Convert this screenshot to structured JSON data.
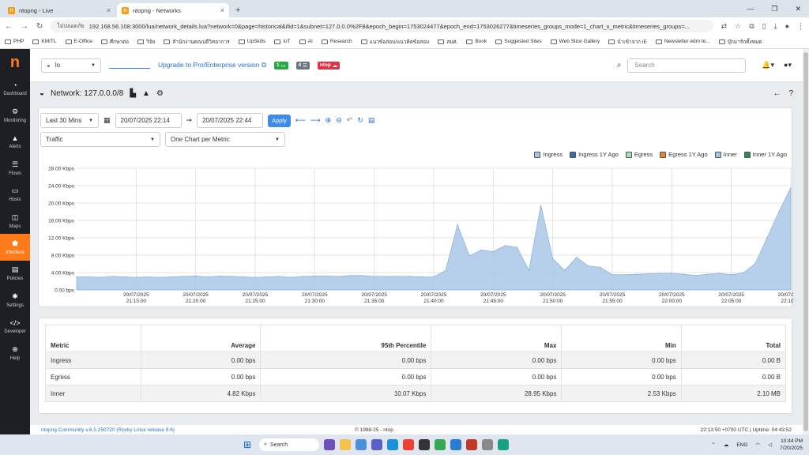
{
  "browser": {
    "tabs": [
      {
        "title": "ntopng - Live",
        "active": false
      },
      {
        "title": "ntopng - Networks",
        "active": true
      }
    ],
    "security_label": "ไม่ปลอดภัย",
    "url": "192.168.56.108:3000/lua/network_details.lua?network=0&page=historical&ifid=1&subnet=127.0.0.0%2F8&epoch_begin=1753024477&epoch_end=1753026277&timeseries_groups_mode=1_chart_x_metric&timeseries_groups=...",
    "bookmarks": [
      "PHP",
      "KMITL",
      "E-Office",
      "ศึกษาต่อ",
      "วิจัย",
      "สำนักงานคณบดีวิทยาการ",
      "UpSkills",
      "IoT",
      "AI",
      "Research",
      "แนวข้อสอบ/แนวคิดข้อสอบ",
      "สมศ.",
      "Book",
      "Suggested Sites",
      "Web Slice Gallery",
      "นำเข้าจาก IE",
      "Newsletter edm te...",
      "บุ๊กมาร์กทั้งหมด"
    ]
  },
  "sidebar": {
    "logo": "n",
    "items": [
      {
        "label": "Dashboard",
        "icon": "gauge-icon",
        "glyph": "◔"
      },
      {
        "label": "Monitoring",
        "icon": "monitoring-icon",
        "glyph": "⚙"
      },
      {
        "label": "Alerts",
        "icon": "warning-icon",
        "glyph": "▲"
      },
      {
        "label": "Flows",
        "icon": "list-icon",
        "glyph": "☰"
      },
      {
        "label": "Hosts",
        "icon": "laptop-icon",
        "glyph": "▭"
      },
      {
        "label": "Maps",
        "icon": "map-icon",
        "glyph": "◫"
      },
      {
        "label": "Interface",
        "icon": "ethernet-icon",
        "glyph": "⬟",
        "active": true
      },
      {
        "label": "Policies",
        "icon": "book-icon",
        "glyph": "▤"
      },
      {
        "label": "Settings",
        "icon": "settings-icon",
        "glyph": "✱"
      },
      {
        "label": "Developer",
        "icon": "code-icon",
        "glyph": "</>"
      },
      {
        "label": "Help",
        "icon": "help-icon",
        "glyph": "⊕"
      }
    ]
  },
  "topnav": {
    "interface": "lo",
    "upgrade_link": "Upgrade to Pro/Enterprise version",
    "badges": [
      "1",
      "4",
      "ntop"
    ],
    "search_placeholder": "Search"
  },
  "page": {
    "title": "Network: 127.0.0.0/8"
  },
  "controls": {
    "range": "Last 30 Mins",
    "date_begin": "20/07/2025 22:14",
    "date_end": "20/07/2025 22:44",
    "apply": "Apply",
    "metric_group": "Traffic",
    "chart_mode": "One Chart per Metric"
  },
  "legend": [
    {
      "label": "Ingress",
      "color": "#a9c8e8"
    },
    {
      "label": "Ingress 1Y Ago",
      "color": "#3b6db3"
    },
    {
      "label": "Egress",
      "color": "#a8e0b5"
    },
    {
      "label": "Egress 1Y Ago",
      "color": "#e8822b"
    },
    {
      "label": "Inner",
      "color": "#a9c8e8"
    },
    {
      "label": "Inner 1Y Ago",
      "color": "#2e8b57"
    }
  ],
  "chart_data": {
    "type": "area",
    "title": "",
    "xlabel": "",
    "ylabel": "",
    "ylim": [
      0,
      28
    ],
    "y_unit": "Kbps",
    "y_ticks": [
      "0.00 bps",
      "4.00 Kbps",
      "8.00 Kbps",
      "12.00 Kbps",
      "16.00 Kbps",
      "20.00 Kbps",
      "24.00 Kbps",
      "28.00 Kbps"
    ],
    "x_ticks": [
      {
        "d": "20/07/2025",
        "t": "21:15:00"
      },
      {
        "d": "20/07/2025",
        "t": "21:20:00"
      },
      {
        "d": "20/07/2025",
        "t": "21:25:00"
      },
      {
        "d": "20/07/2025",
        "t": "21:30:00"
      },
      {
        "d": "20/07/2025",
        "t": "21:35:00"
      },
      {
        "d": "20/07/2025",
        "t": "21:40:00"
      },
      {
        "d": "20/07/2025",
        "t": "21:45:00"
      },
      {
        "d": "20/07/2025",
        "t": "21:50:00"
      },
      {
        "d": "20/07/2025",
        "t": "21:55:00"
      },
      {
        "d": "20/07/2025",
        "t": "22:00:00"
      },
      {
        "d": "20/07/2025",
        "t": "22:05:00"
      },
      {
        "d": "20/07/2025",
        "t": "22:10:00"
      }
    ],
    "x_range_minutes": [
      0,
      60
    ],
    "series": [
      {
        "name": "Inner",
        "color": "#a9c8e8",
        "x": [
          0,
          1,
          2,
          3,
          4,
          5,
          6,
          7,
          8,
          9,
          10,
          11,
          12,
          13,
          14,
          15,
          16,
          17,
          18,
          19,
          20,
          21,
          22,
          23,
          24,
          25,
          26,
          27,
          28,
          29,
          30,
          31,
          32,
          33,
          34,
          35,
          36,
          37,
          38,
          39,
          40,
          41,
          42,
          43,
          44,
          45,
          46,
          47,
          48,
          49,
          50,
          51,
          52,
          53,
          54,
          55,
          56,
          57,
          58,
          59,
          60
        ],
        "values": [
          3.0,
          3.0,
          2.9,
          3.1,
          3.0,
          2.9,
          3.0,
          2.9,
          3.0,
          3.1,
          3.2,
          3.0,
          3.2,
          3.1,
          3.0,
          2.9,
          3.0,
          3.1,
          2.9,
          3.1,
          3.2,
          3.2,
          3.1,
          3.3,
          3.3,
          3.1,
          3.1,
          3.1,
          3.1,
          3.0,
          3.0,
          4.5,
          15.0,
          7.8,
          9.2,
          8.8,
          10.2,
          9.8,
          4.5,
          19.5,
          7.2,
          4.5,
          7.5,
          5.5,
          5.2,
          3.5,
          3.5,
          3.6,
          3.7,
          3.8,
          3.8,
          3.6,
          3.3,
          3.6,
          3.8,
          3.5,
          3.9,
          6.0,
          12.0,
          18.0,
          23.5
        ]
      }
    ]
  },
  "stats_table": {
    "headers": [
      "Metric",
      "Average",
      "95th Percentile",
      "Max",
      "Min",
      "Total"
    ],
    "rows": [
      [
        "Ingress",
        "0.00 bps",
        "0.00 bps",
        "0.00 bps",
        "0.00 bps",
        "0.00 B"
      ],
      [
        "Egress",
        "0.00 bps",
        "0.00 bps",
        "0.00 bps",
        "0.00 bps",
        "0.00 B"
      ],
      [
        "Inner",
        "4.82 Kbps",
        "10.07 Kbps",
        "28.95 Kbps",
        "2.53 Kbps",
        "2.10 MB"
      ]
    ]
  },
  "footer": {
    "version": "ntopng Community v.6.5.250720 (Rocky Linux release 9.6)",
    "copyright": "© 1998-25 - ntop",
    "uptime": "22:13:50 +0700 UTC | Uptime: 04:43:52"
  },
  "taskbar": {
    "search": "Search",
    "lang": "ENG",
    "time": "10:44 PM",
    "date": "7/20/2025"
  }
}
